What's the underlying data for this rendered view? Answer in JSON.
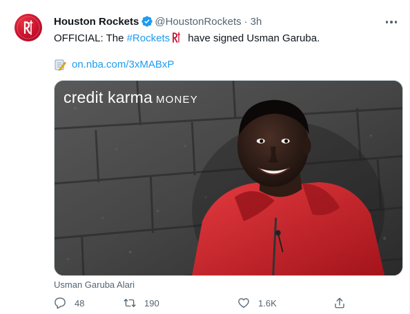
{
  "tweet": {
    "author_name": "Houston Rockets",
    "handle": "@HoustonRockets",
    "separator": "·",
    "time": "3h",
    "text_before": "OFFICIAL: The ",
    "hashtag": "#Rockets",
    "text_after": " have signed Usman Garuba.",
    "link": "on.nba.com/3xMABxP",
    "media": {
      "brand": "credit karma",
      "brand_suffix": "MONEY",
      "caption": "Usman Garuba Alari"
    },
    "actions": {
      "replies": "48",
      "retweets": "190",
      "likes": "1.6K"
    }
  },
  "colors": {
    "accent": "#1d9bf0",
    "brand_red": "#c8102e",
    "secondary_text": "#536471",
    "jacket_red": "#d9232b"
  },
  "icons": [
    "rockets-logo-icon",
    "verified-badge-icon",
    "more-icon",
    "memo-icon",
    "rockets-mini-icon",
    "reply-icon",
    "retweet-icon",
    "like-icon",
    "share-icon"
  ]
}
